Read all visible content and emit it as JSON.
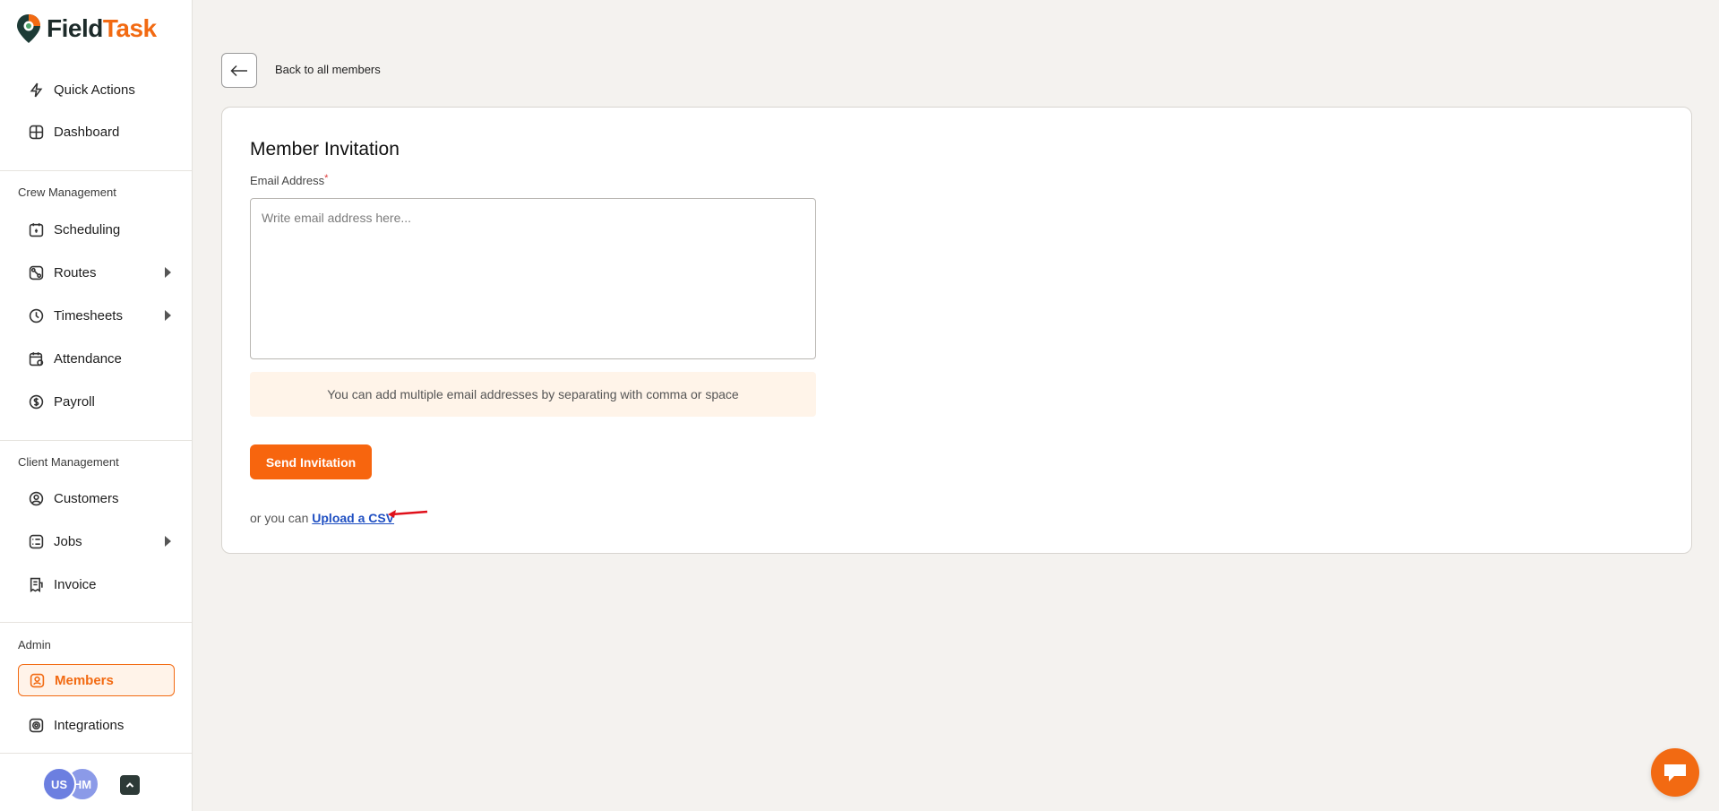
{
  "brand": {
    "name_part1": "Field",
    "name_part2": "Task",
    "accent": "#f26a12"
  },
  "sidebar": {
    "top_items": [
      {
        "label": "Quick Actions",
        "icon": "lightning-icon"
      },
      {
        "label": "Dashboard",
        "icon": "dashboard-icon"
      }
    ],
    "crew_section": "Crew Management",
    "crew_items": [
      {
        "label": "Scheduling",
        "icon": "calendar-icon"
      },
      {
        "label": "Routes",
        "icon": "route-icon",
        "expandable": true
      },
      {
        "label": "Timesheets",
        "icon": "clock-icon",
        "expandable": true
      },
      {
        "label": "Attendance",
        "icon": "calendar-check-icon"
      },
      {
        "label": "Payroll",
        "icon": "dollar-icon"
      }
    ],
    "client_section": "Client Management",
    "client_items": [
      {
        "label": "Customers",
        "icon": "user-circle-icon"
      },
      {
        "label": "Jobs",
        "icon": "list-icon",
        "expandable": true
      },
      {
        "label": "Invoice",
        "icon": "invoice-icon"
      }
    ],
    "admin_section": "Admin",
    "admin_items": [
      {
        "label": "Members",
        "icon": "member-icon",
        "active": true
      },
      {
        "label": "Integrations",
        "icon": "integrations-icon"
      }
    ],
    "users": [
      "US",
      "HM"
    ]
  },
  "back": {
    "label": "Back to all members"
  },
  "form": {
    "title": "Member Invitation",
    "email_label": "Email Address",
    "required_mark": "*",
    "email_placeholder": "Write email address here...",
    "email_value": "",
    "hint": "You can add multiple email addresses by separating with comma or space",
    "send_label": "Send Invitation",
    "csv_prefix": "or you can",
    "csv_link": "Upload a CSV"
  }
}
